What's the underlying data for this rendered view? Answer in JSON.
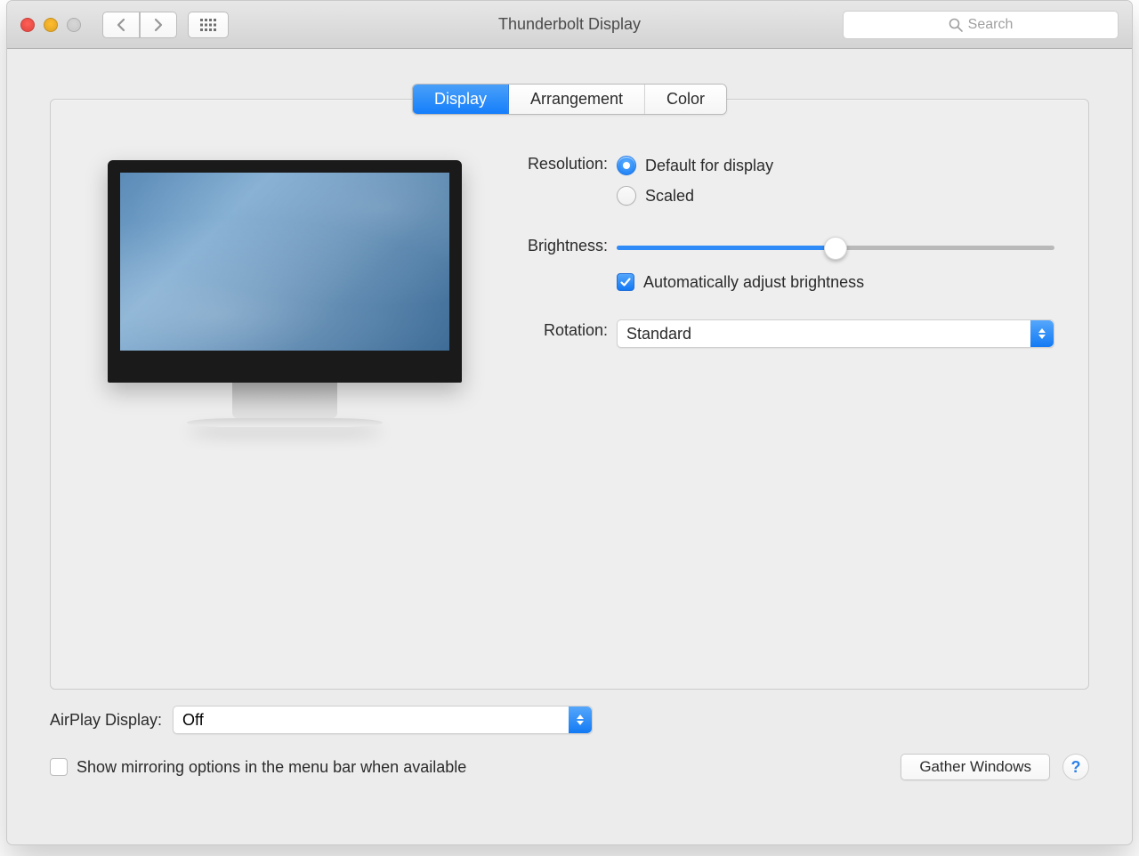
{
  "window": {
    "title": "Thunderbolt Display"
  },
  "toolbar": {
    "searchPlaceholder": "Search"
  },
  "tabs": {
    "display": "Display",
    "arrangement": "Arrangement",
    "color": "Color",
    "active": "Display"
  },
  "resolution": {
    "label": "Resolution:",
    "options": {
      "default": "Default for display",
      "scaled": "Scaled"
    },
    "selected": "default"
  },
  "brightness": {
    "label": "Brightness:",
    "valuePercent": 50,
    "auto": {
      "checked": true,
      "label": "Automatically adjust brightness"
    }
  },
  "rotation": {
    "label": "Rotation:",
    "value": "Standard"
  },
  "airplay": {
    "label": "AirPlay Display:",
    "value": "Off"
  },
  "mirroring": {
    "checked": false,
    "label": "Show mirroring options in the menu bar when available"
  },
  "buttons": {
    "gather": "Gather Windows",
    "help": "?"
  }
}
